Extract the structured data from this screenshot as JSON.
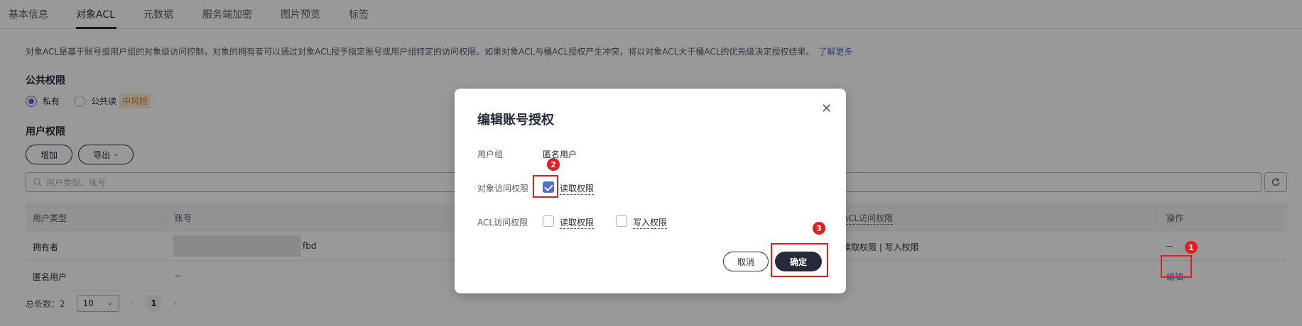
{
  "tabs": [
    "基本信息",
    "对象ACL",
    "元数据",
    "服务端加密",
    "图片预览",
    "标签"
  ],
  "description": "对象ACL是基于账号或用户组的对象级访问控制，对象的拥有者可以通过对象ACL授予指定账号或用户组特定的访问权限。如果对象ACL与桶ACL授权产生冲突，将以对象ACL大于桶ACL的优先级决定授权结果。",
  "learn_more": "了解更多",
  "public_perm": {
    "title": "公共权限",
    "private_label": "私有",
    "public_read_label": "公共读",
    "risk_tag": "中风险"
  },
  "user_perm": {
    "title": "用户权限",
    "add_button": "增加",
    "export_button": "导出",
    "search_placeholder": "用户类型、账号"
  },
  "table": {
    "headers": [
      "用户类型",
      "账号",
      "ACL访问权限",
      "操作"
    ],
    "rows": [
      {
        "type": "拥有者",
        "account": "fbd",
        "acl": "读取权限 | 写入权限",
        "op": "--"
      },
      {
        "type": "匿名用户",
        "account": "--",
        "acl": "",
        "op": "编辑"
      }
    ]
  },
  "pager": {
    "total": "总条数：2",
    "size": "10",
    "page": "1"
  },
  "dialog": {
    "title": "编辑账号授权",
    "group_label": "用户组",
    "group_value": "匿名用户",
    "object_perm_label": "对象访问权限",
    "object_read": "读取权限",
    "object_read_checked": true,
    "acl_perm_label": "ACL访问权限",
    "acl_read": "读取权限",
    "acl_read_checked": false,
    "acl_write": "写入权限",
    "acl_write_checked": false,
    "cancel": "取消",
    "ok": "确定"
  },
  "annotations": [
    "1",
    "2",
    "3"
  ],
  "colors": {
    "link": "#526ecc",
    "highlight": "#e11d1d",
    "dark": "#252b3a"
  }
}
